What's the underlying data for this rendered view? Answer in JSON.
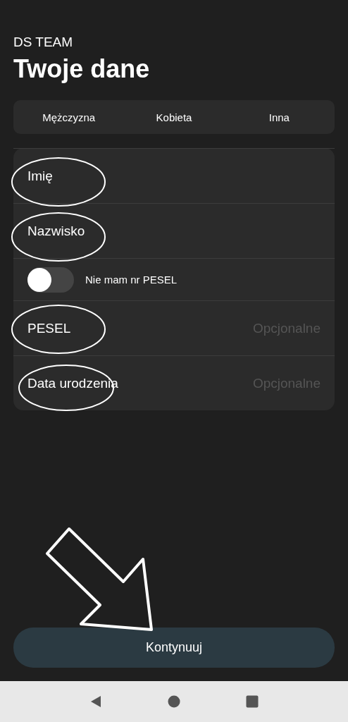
{
  "header": {
    "brand": "DS TEAM",
    "title": "Twoje dane"
  },
  "gender_options": [
    {
      "label": "Mężczyzna",
      "selected": false
    },
    {
      "label": "Kobieta",
      "selected": false
    },
    {
      "label": "Inna",
      "selected": false
    }
  ],
  "form": [
    {
      "kind": "field",
      "label": "Imię"
    },
    {
      "kind": "field",
      "label": "Nazwisko"
    },
    {
      "kind": "toggle",
      "label": "Nie mam nr PESEL",
      "on": false
    },
    {
      "kind": "field",
      "label": "PESEL",
      "placeholder": "Opcjonalne"
    },
    {
      "kind": "field",
      "label": "Data urodzenia",
      "placeholder": "Opcjonalne"
    }
  ],
  "button": {
    "label": "Kontynuuj"
  }
}
